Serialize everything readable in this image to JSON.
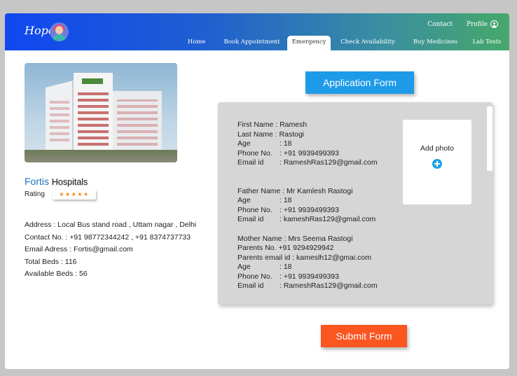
{
  "app": {
    "brand": "Hope"
  },
  "header": {
    "contact_label": "Contact",
    "profile_label": "Profile",
    "nav": [
      "Home",
      "Book Appointment",
      "Emergency",
      "Check Availability",
      "Buy Medicines",
      "Lab Tests"
    ],
    "active_tab": "Emergency"
  },
  "hospital": {
    "name_brand": "Fortis",
    "name_word": "Hospitals",
    "rating_label": "Rating",
    "rating_stars": "★★★★★",
    "rating_value": 4.5,
    "address": "Address : Local Bus stand road , Uttam nagar , Delhi",
    "contact": "Contact No. : +91 98772344242 , +91 8374737733",
    "email": "Email Adress : Fortis@gmail.com",
    "total_beds": "Total Beds : 116",
    "available_beds": "Available Beds : 56"
  },
  "form": {
    "title": "Application Form",
    "add_photo_label": "Add photo",
    "submit_label": "Submit Form",
    "patient": {
      "first_name": "First Name : Ramesh",
      "last_name": "Last Name : Rastogi",
      "age_label": "Age",
      "age_value": ": 18",
      "phone_label": "Phone No.",
      "phone_value": ": +91 9939499393",
      "email_label": "Email id",
      "email_value": ":  RameshRas129@gmail.com"
    },
    "father": {
      "name": "Father Name : Mr Kamlesh Rastogi",
      "age_label": "Age",
      "age_value": ": 18",
      "phone_label": "Phone No.",
      "phone_value": ": +91 9939499393",
      "email_label": "Email id",
      "email_value": ":  kameshRas129@gmail.com"
    },
    "mother": {
      "name": "Mother Name : Mrs Seema Rastogi",
      "parents_no": "Parents No. +91 9294929942",
      "parents_email": "Parents email id : kameslh12@gmai.com",
      "age_label": "Age",
      "age_value": ": 18",
      "phone_label": "Phone No.",
      "phone_value": ": +91 9939499393",
      "email_label": "Email id",
      "email_value": ":  RameshRas129@gmail.com"
    }
  },
  "colors": {
    "header_start": "#1047f0",
    "header_end": "#46a86a",
    "form_title_bg": "#1e9be8",
    "submit_bg": "#fb5520",
    "panel_bg": "#d6d6d6",
    "hospital_name": "#1a73c0"
  },
  "icons": [
    "avatar-icon",
    "user-icon",
    "plus-icon"
  ]
}
